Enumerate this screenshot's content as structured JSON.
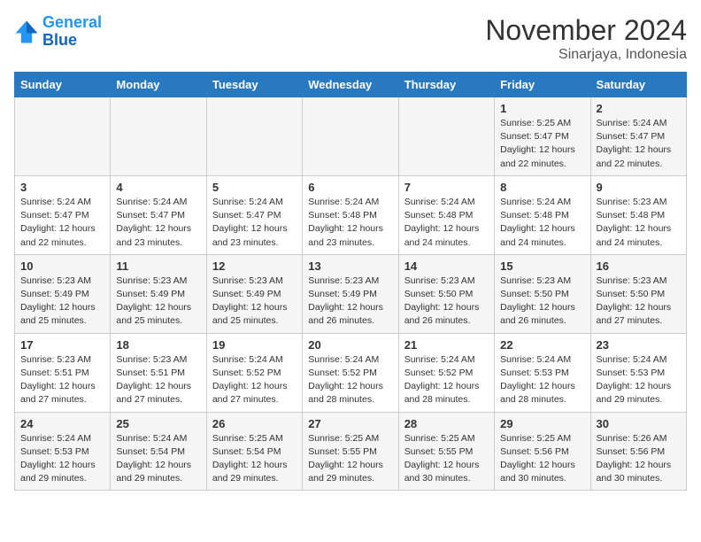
{
  "header": {
    "logo_line1": "General",
    "logo_line2": "Blue",
    "month_year": "November 2024",
    "location": "Sinarjaya, Indonesia"
  },
  "weekdays": [
    "Sunday",
    "Monday",
    "Tuesday",
    "Wednesday",
    "Thursday",
    "Friday",
    "Saturday"
  ],
  "weeks": [
    [
      {
        "day": "",
        "info": ""
      },
      {
        "day": "",
        "info": ""
      },
      {
        "day": "",
        "info": ""
      },
      {
        "day": "",
        "info": ""
      },
      {
        "day": "",
        "info": ""
      },
      {
        "day": "1",
        "info": "Sunrise: 5:25 AM\nSunset: 5:47 PM\nDaylight: 12 hours\nand 22 minutes."
      },
      {
        "day": "2",
        "info": "Sunrise: 5:24 AM\nSunset: 5:47 PM\nDaylight: 12 hours\nand 22 minutes."
      }
    ],
    [
      {
        "day": "3",
        "info": "Sunrise: 5:24 AM\nSunset: 5:47 PM\nDaylight: 12 hours\nand 22 minutes."
      },
      {
        "day": "4",
        "info": "Sunrise: 5:24 AM\nSunset: 5:47 PM\nDaylight: 12 hours\nand 23 minutes."
      },
      {
        "day": "5",
        "info": "Sunrise: 5:24 AM\nSunset: 5:47 PM\nDaylight: 12 hours\nand 23 minutes."
      },
      {
        "day": "6",
        "info": "Sunrise: 5:24 AM\nSunset: 5:48 PM\nDaylight: 12 hours\nand 23 minutes."
      },
      {
        "day": "7",
        "info": "Sunrise: 5:24 AM\nSunset: 5:48 PM\nDaylight: 12 hours\nand 24 minutes."
      },
      {
        "day": "8",
        "info": "Sunrise: 5:24 AM\nSunset: 5:48 PM\nDaylight: 12 hours\nand 24 minutes."
      },
      {
        "day": "9",
        "info": "Sunrise: 5:23 AM\nSunset: 5:48 PM\nDaylight: 12 hours\nand 24 minutes."
      }
    ],
    [
      {
        "day": "10",
        "info": "Sunrise: 5:23 AM\nSunset: 5:49 PM\nDaylight: 12 hours\nand 25 minutes."
      },
      {
        "day": "11",
        "info": "Sunrise: 5:23 AM\nSunset: 5:49 PM\nDaylight: 12 hours\nand 25 minutes."
      },
      {
        "day": "12",
        "info": "Sunrise: 5:23 AM\nSunset: 5:49 PM\nDaylight: 12 hours\nand 25 minutes."
      },
      {
        "day": "13",
        "info": "Sunrise: 5:23 AM\nSunset: 5:49 PM\nDaylight: 12 hours\nand 26 minutes."
      },
      {
        "day": "14",
        "info": "Sunrise: 5:23 AM\nSunset: 5:50 PM\nDaylight: 12 hours\nand 26 minutes."
      },
      {
        "day": "15",
        "info": "Sunrise: 5:23 AM\nSunset: 5:50 PM\nDaylight: 12 hours\nand 26 minutes."
      },
      {
        "day": "16",
        "info": "Sunrise: 5:23 AM\nSunset: 5:50 PM\nDaylight: 12 hours\nand 27 minutes."
      }
    ],
    [
      {
        "day": "17",
        "info": "Sunrise: 5:23 AM\nSunset: 5:51 PM\nDaylight: 12 hours\nand 27 minutes."
      },
      {
        "day": "18",
        "info": "Sunrise: 5:23 AM\nSunset: 5:51 PM\nDaylight: 12 hours\nand 27 minutes."
      },
      {
        "day": "19",
        "info": "Sunrise: 5:24 AM\nSunset: 5:52 PM\nDaylight: 12 hours\nand 27 minutes."
      },
      {
        "day": "20",
        "info": "Sunrise: 5:24 AM\nSunset: 5:52 PM\nDaylight: 12 hours\nand 28 minutes."
      },
      {
        "day": "21",
        "info": "Sunrise: 5:24 AM\nSunset: 5:52 PM\nDaylight: 12 hours\nand 28 minutes."
      },
      {
        "day": "22",
        "info": "Sunrise: 5:24 AM\nSunset: 5:53 PM\nDaylight: 12 hours\nand 28 minutes."
      },
      {
        "day": "23",
        "info": "Sunrise: 5:24 AM\nSunset: 5:53 PM\nDaylight: 12 hours\nand 29 minutes."
      }
    ],
    [
      {
        "day": "24",
        "info": "Sunrise: 5:24 AM\nSunset: 5:53 PM\nDaylight: 12 hours\nand 29 minutes."
      },
      {
        "day": "25",
        "info": "Sunrise: 5:24 AM\nSunset: 5:54 PM\nDaylight: 12 hours\nand 29 minutes."
      },
      {
        "day": "26",
        "info": "Sunrise: 5:25 AM\nSunset: 5:54 PM\nDaylight: 12 hours\nand 29 minutes."
      },
      {
        "day": "27",
        "info": "Sunrise: 5:25 AM\nSunset: 5:55 PM\nDaylight: 12 hours\nand 29 minutes."
      },
      {
        "day": "28",
        "info": "Sunrise: 5:25 AM\nSunset: 5:55 PM\nDaylight: 12 hours\nand 30 minutes."
      },
      {
        "day": "29",
        "info": "Sunrise: 5:25 AM\nSunset: 5:56 PM\nDaylight: 12 hours\nand 30 minutes."
      },
      {
        "day": "30",
        "info": "Sunrise: 5:26 AM\nSunset: 5:56 PM\nDaylight: 12 hours\nand 30 minutes."
      }
    ]
  ]
}
